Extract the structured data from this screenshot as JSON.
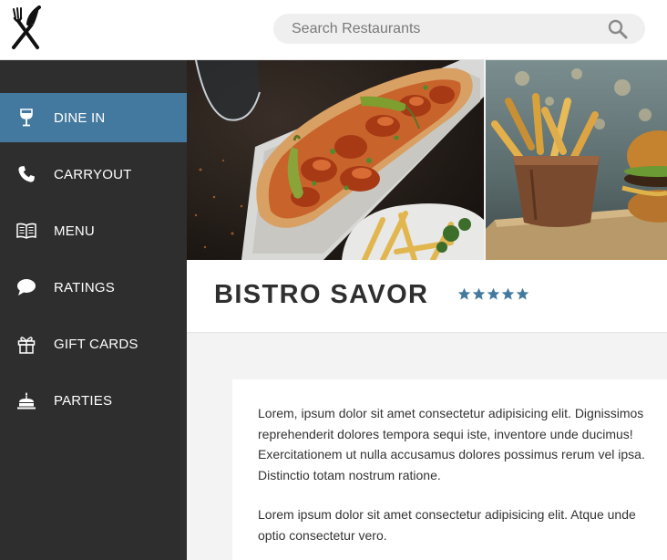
{
  "header": {
    "logo_icon": "fork-knife-icon",
    "search": {
      "placeholder": "Search Restaurants",
      "icon": "search-icon"
    }
  },
  "sidebar": {
    "items": [
      {
        "label": "DINE IN",
        "icon": "wine-glass-icon",
        "active": true
      },
      {
        "label": "CARRYOUT",
        "icon": "phone-icon",
        "active": false
      },
      {
        "label": "MENU",
        "icon": "book-icon",
        "active": false
      },
      {
        "label": "RATINGS",
        "icon": "speech-bubble-icon",
        "active": false
      },
      {
        "label": "GIFT CARDS",
        "icon": "gift-icon",
        "active": false
      },
      {
        "label": "PARTIES",
        "icon": "cake-icon",
        "active": false
      }
    ]
  },
  "restaurant": {
    "name": "BISTRO SAVOR",
    "rating": 5,
    "rating_max": 5
  },
  "description": {
    "paragraph_1": "Lorem, ipsum dolor sit amet consectetur adipisicing elit. Dignissimos reprehenderit dolores tempora sequi iste, inventore unde ducimus! Exercitationem ut nulla accusamus dolores possimus rerum vel ipsa. Distinctio totam nostrum ratione.",
    "paragraph_2": "Lorem ipsum dolor sit amet consectetur adipisicing elit. Atque unde optio consectetur vero."
  },
  "colors": {
    "accent": "#44799f",
    "sidebar_bg": "#2e2e2e",
    "star": "#44799f"
  }
}
